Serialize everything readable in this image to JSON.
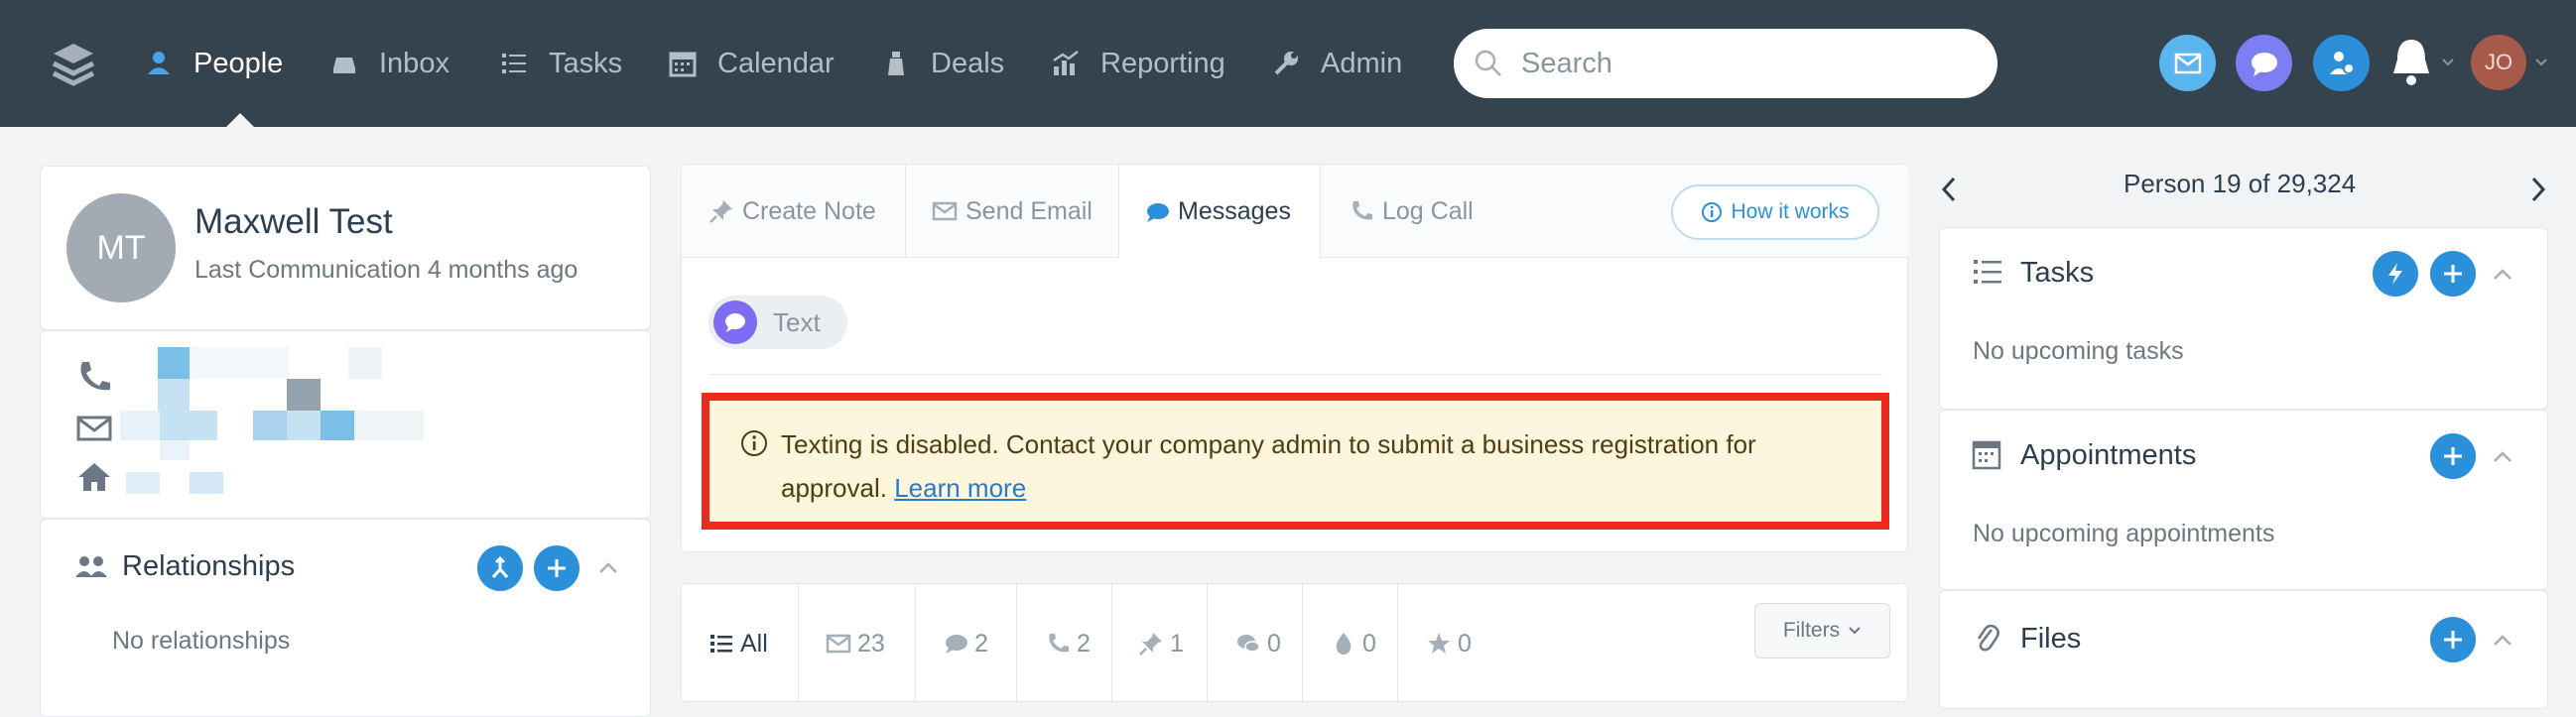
{
  "nav": {
    "items": [
      {
        "label": "People",
        "icon": "people-icon",
        "active": true
      },
      {
        "label": "Inbox",
        "icon": "inbox-icon"
      },
      {
        "label": "Tasks",
        "icon": "tasks-list-icon"
      },
      {
        "label": "Calendar",
        "icon": "calendar-icon"
      },
      {
        "label": "Deals",
        "icon": "deals-icon"
      },
      {
        "label": "Reporting",
        "icon": "reporting-icon"
      },
      {
        "label": "Admin",
        "icon": "wrench-icon"
      }
    ],
    "search_placeholder": "Search",
    "user_initials": "JO"
  },
  "person": {
    "initials": "MT",
    "name": "Maxwell Test",
    "last_communication": "Last Communication 4 months ago"
  },
  "relationships": {
    "title": "Relationships",
    "empty": "No relationships"
  },
  "composer": {
    "tabs": [
      "Create Note",
      "Send Email",
      "Messages",
      "Log Call"
    ],
    "active_tab": "Messages",
    "how_it_works": "How it works",
    "text_pill": "Text",
    "alert": {
      "text": "Texting is disabled. Contact your company admin to submit a business registration for approval.",
      "link": "Learn more"
    }
  },
  "activity": {
    "tabs": [
      {
        "label": "All",
        "icon": "list-icon"
      },
      {
        "label": "23",
        "icon": "email-icon"
      },
      {
        "label": "2",
        "icon": "message-icon"
      },
      {
        "label": "2",
        "icon": "phone-icon"
      },
      {
        "label": "1",
        "icon": "pin-icon"
      },
      {
        "label": "0",
        "icon": "chat-bubbles-icon"
      },
      {
        "label": "0",
        "icon": "drop-icon"
      },
      {
        "label": "0",
        "icon": "star-icon"
      }
    ],
    "filters": "Filters"
  },
  "pager": {
    "text": "Person 19 of 29,324"
  },
  "sidebar": {
    "tasks": {
      "title": "Tasks",
      "empty": "No upcoming tasks"
    },
    "appointments": {
      "title": "Appointments",
      "empty": "No upcoming appointments"
    },
    "files": {
      "title": "Files"
    }
  },
  "colors": {
    "topbar": "#35434f",
    "accent": "#2b90d9",
    "alert_border": "#ea2a1f",
    "alert_bg": "#fdf5dc"
  }
}
